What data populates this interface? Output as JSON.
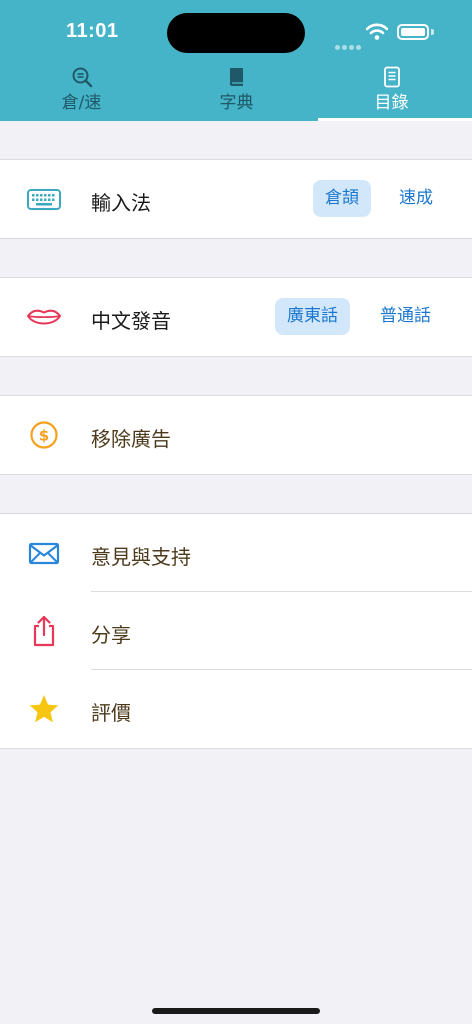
{
  "status": {
    "time": "11:01"
  },
  "tabs": [
    {
      "label": "倉/速",
      "icon": "magnifier-icon",
      "active": false
    },
    {
      "label": "字典",
      "icon": "book-icon",
      "active": false
    },
    {
      "label": "目錄",
      "icon": "list-icon",
      "active": true
    }
  ],
  "settings": {
    "input_method": {
      "label": "輸入法",
      "icon": "keyboard-icon",
      "options": [
        "倉頡",
        "速成"
      ],
      "selected": "倉頡"
    },
    "pronunciation": {
      "label": "中文發音",
      "icon": "lips-icon",
      "options": [
        "廣東話",
        "普通話"
      ],
      "selected": "廣東話"
    },
    "remove_ads": {
      "label": "移除廣告",
      "icon": "dollar-coin-icon"
    },
    "feedback": {
      "label": "意見與支持",
      "icon": "envelope-icon"
    },
    "share": {
      "label": "分享",
      "icon": "share-icon"
    },
    "rate": {
      "label": "評價",
      "icon": "star-icon"
    }
  },
  "colors": {
    "header": "#46b4c8",
    "accent_blue": "#1a78d0",
    "selected_bg": "#d3e7fa",
    "keyboard": "#3aa9bf",
    "lips": "#e8385a",
    "coin": "#f5a01e",
    "envelope": "#2a86d9",
    "share": "#e8385a",
    "star": "#f7c613"
  }
}
